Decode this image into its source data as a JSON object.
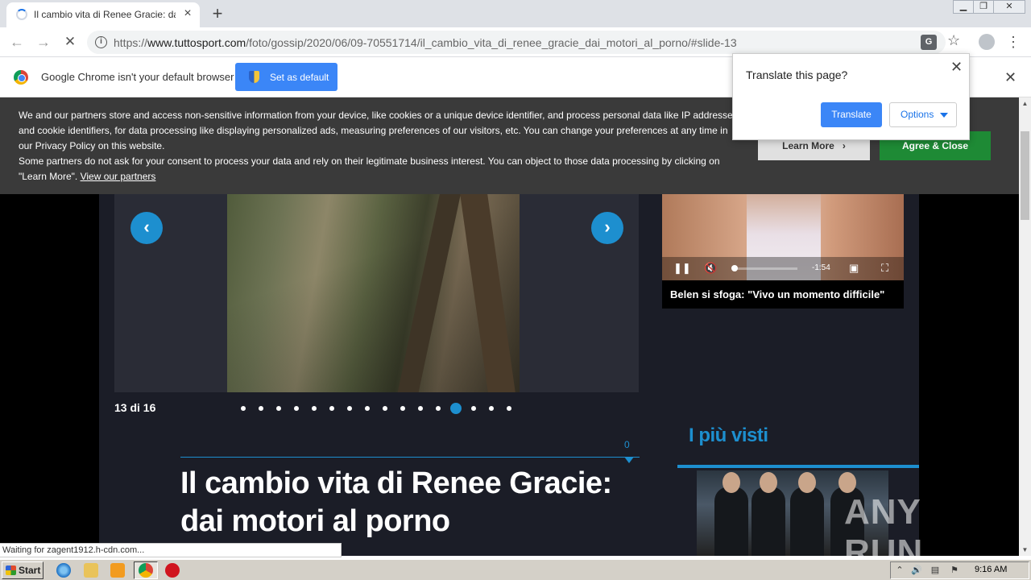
{
  "browser": {
    "tab_title": "Il cambio vita di Renee Gracie: dai m",
    "new_tab": "+",
    "url_prefix": "https://",
    "url_host": "www.tuttosport.com",
    "url_path": "/foto/gossip/2020/06/09-70551714/il_cambio_vita_di_renee_gracie_dai_motori_al_porno/#slide-13"
  },
  "infobar": {
    "message": "Google Chrome isn't your default browser",
    "set_default": "Set as default"
  },
  "translate_popup": {
    "title": "Translate this page?",
    "translate": "Translate",
    "options": "Options"
  },
  "cookie_banner": {
    "text_1": "We and our partners store and access non-sensitive information from your device, like cookies or a unique device identifier, and process personal data like IP addresses and cookie identifiers, for data processing like displaying personalized ads, measuring preferences of our visitors, etc. You can change your preferences at any time in our Privacy Policy on this website.",
    "text_2": "Some partners do not ask for your consent to process your data and rely on their legitimate business interest. You can object to those data processing by clicking on \"Learn More\". ",
    "link": "View our partners",
    "learn_more": "Learn More",
    "learn_more_arrow": "›",
    "agree": "Agree & Close"
  },
  "gallery": {
    "counter": "13 di 16",
    "current": 13,
    "total": 16,
    "prev": "‹",
    "next": "›"
  },
  "article": {
    "comments": "0",
    "headline": "Il cambio vita di Renee Gracie: dai motori al porno"
  },
  "video": {
    "time": "-1:54",
    "caption": "Belen si sfoga: \"Vivo un momento difficile\""
  },
  "sidebar": {
    "most_viewed": "I più visti"
  },
  "watermark": "ANY RUN",
  "status_bar": "Waiting for zagent1912.h-cdn.com...",
  "taskbar": {
    "start": "Start",
    "clock": "9:16 AM"
  }
}
